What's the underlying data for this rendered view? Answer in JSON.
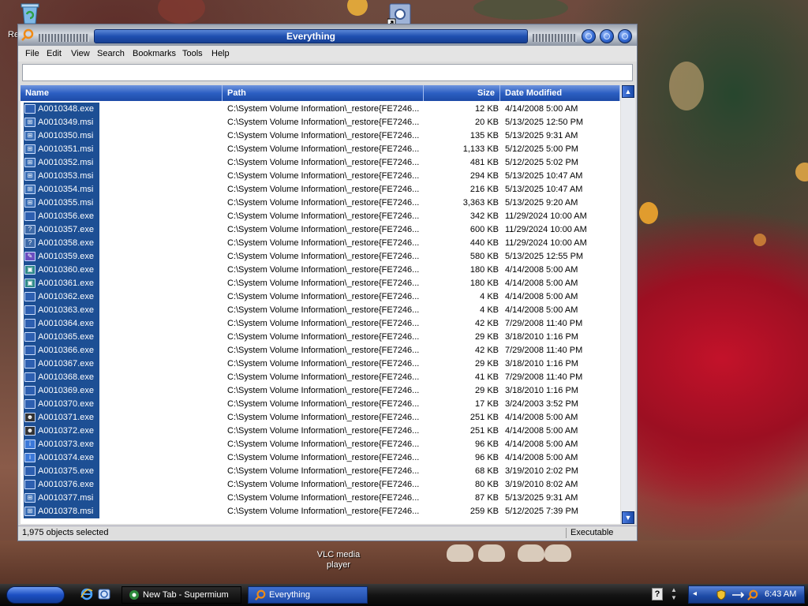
{
  "desktop": {
    "icons": [
      {
        "name": "recycle-bin-icon",
        "label": "Re"
      },
      {
        "name": "shortcut-icon",
        "label": ""
      },
      {
        "name": "vlc-media-player-icon",
        "label": "VLC media player"
      }
    ]
  },
  "window": {
    "title": "Everything",
    "menu": [
      "File",
      "Edit",
      "View",
      "Search",
      "Bookmarks",
      "Tools",
      "Help"
    ],
    "search_value": "",
    "columns": {
      "name": "Name",
      "path": "Path",
      "size": "Size",
      "date": "Date Modified"
    },
    "rows": [
      {
        "name": "A0010348.exe",
        "icon": "exe",
        "path": "C:\\System Volume Information\\_restore{FE7246...",
        "size": "12 KB",
        "date": "4/14/2008 5:00 AM"
      },
      {
        "name": "A0010349.msi",
        "icon": "msi",
        "path": "C:\\System Volume Information\\_restore{FE7246...",
        "size": "20 KB",
        "date": "5/13/2025 12:50 PM"
      },
      {
        "name": "A0010350.msi",
        "icon": "msi",
        "path": "C:\\System Volume Information\\_restore{FE7246...",
        "size": "135 KB",
        "date": "5/13/2025 9:31 AM"
      },
      {
        "name": "A0010351.msi",
        "icon": "msi",
        "path": "C:\\System Volume Information\\_restore{FE7246...",
        "size": "1,133 KB",
        "date": "5/12/2025 5:00 PM"
      },
      {
        "name": "A0010352.msi",
        "icon": "msi",
        "path": "C:\\System Volume Information\\_restore{FE7246...",
        "size": "481 KB",
        "date": "5/12/2025 5:02 PM"
      },
      {
        "name": "A0010353.msi",
        "icon": "msi",
        "path": "C:\\System Volume Information\\_restore{FE7246...",
        "size": "294 KB",
        "date": "5/13/2025 10:47 AM"
      },
      {
        "name": "A0010354.msi",
        "icon": "msi",
        "path": "C:\\System Volume Information\\_restore{FE7246...",
        "size": "216 KB",
        "date": "5/13/2025 10:47 AM"
      },
      {
        "name": "A0010355.msi",
        "icon": "msi",
        "path": "C:\\System Volume Information\\_restore{FE7246...",
        "size": "3,363 KB",
        "date": "5/13/2025 9:20 AM"
      },
      {
        "name": "A0010356.exe",
        "icon": "exe",
        "path": "C:\\System Volume Information\\_restore{FE7246...",
        "size": "342 KB",
        "date": "11/29/2024 10:00 AM"
      },
      {
        "name": "A0010357.exe",
        "icon": "help",
        "path": "C:\\System Volume Information\\_restore{FE7246...",
        "size": "600 KB",
        "date": "11/29/2024 10:00 AM"
      },
      {
        "name": "A0010358.exe",
        "icon": "help",
        "path": "C:\\System Volume Information\\_restore{FE7246...",
        "size": "440 KB",
        "date": "11/29/2024 10:00 AM"
      },
      {
        "name": "A0010359.exe",
        "icon": "pen",
        "path": "C:\\System Volume Information\\_restore{FE7246...",
        "size": "580 KB",
        "date": "5/13/2025 12:55 PM"
      },
      {
        "name": "A0010360.exe",
        "icon": "monitor",
        "path": "C:\\System Volume Information\\_restore{FE7246...",
        "size": "180 KB",
        "date": "4/14/2008 5:00 AM"
      },
      {
        "name": "A0010361.exe",
        "icon": "monitor",
        "path": "C:\\System Volume Information\\_restore{FE7246...",
        "size": "180 KB",
        "date": "4/14/2008 5:00 AM"
      },
      {
        "name": "A0010362.exe",
        "icon": "exe",
        "path": "C:\\System Volume Information\\_restore{FE7246...",
        "size": "4 KB",
        "date": "4/14/2008 5:00 AM"
      },
      {
        "name": "A0010363.exe",
        "icon": "exe",
        "path": "C:\\System Volume Information\\_restore{FE7246...",
        "size": "4 KB",
        "date": "4/14/2008 5:00 AM"
      },
      {
        "name": "A0010364.exe",
        "icon": "exe",
        "path": "C:\\System Volume Information\\_restore{FE7246...",
        "size": "42 KB",
        "date": "7/29/2008 11:40 PM"
      },
      {
        "name": "A0010365.exe",
        "icon": "exe",
        "path": "C:\\System Volume Information\\_restore{FE7246...",
        "size": "29 KB",
        "date": "3/18/2010 1:16 PM"
      },
      {
        "name": "A0010366.exe",
        "icon": "exe",
        "path": "C:\\System Volume Information\\_restore{FE7246...",
        "size": "42 KB",
        "date": "7/29/2008 11:40 PM"
      },
      {
        "name": "A0010367.exe",
        "icon": "exe",
        "path": "C:\\System Volume Information\\_restore{FE7246...",
        "size": "29 KB",
        "date": "3/18/2010 1:16 PM"
      },
      {
        "name": "A0010368.exe",
        "icon": "exe",
        "path": "C:\\System Volume Information\\_restore{FE7246...",
        "size": "41 KB",
        "date": "7/29/2008 11:40 PM"
      },
      {
        "name": "A0010369.exe",
        "icon": "exe",
        "path": "C:\\System Volume Information\\_restore{FE7246...",
        "size": "29 KB",
        "date": "3/18/2010 1:16 PM"
      },
      {
        "name": "A0010370.exe",
        "icon": "exe",
        "path": "C:\\System Volume Information\\_restore{FE7246...",
        "size": "17 KB",
        "date": "3/24/2003 3:52 PM"
      },
      {
        "name": "A0010371.exe",
        "icon": "spy",
        "path": "C:\\System Volume Information\\_restore{FE7246...",
        "size": "251 KB",
        "date": "4/14/2008 5:00 AM"
      },
      {
        "name": "A0010372.exe",
        "icon": "spy",
        "path": "C:\\System Volume Information\\_restore{FE7246...",
        "size": "251 KB",
        "date": "4/14/2008 5:00 AM"
      },
      {
        "name": "A0010373.exe",
        "icon": "info",
        "path": "C:\\System Volume Information\\_restore{FE7246...",
        "size": "96 KB",
        "date": "4/14/2008 5:00 AM"
      },
      {
        "name": "A0010374.exe",
        "icon": "info",
        "path": "C:\\System Volume Information\\_restore{FE7246...",
        "size": "96 KB",
        "date": "4/14/2008 5:00 AM"
      },
      {
        "name": "A0010375.exe",
        "icon": "exe",
        "path": "C:\\System Volume Information\\_restore{FE7246...",
        "size": "68 KB",
        "date": "3/19/2010 2:02 PM"
      },
      {
        "name": "A0010376.exe",
        "icon": "exe",
        "path": "C:\\System Volume Information\\_restore{FE7246...",
        "size": "80 KB",
        "date": "3/19/2010 8:02 AM"
      },
      {
        "name": "A0010377.msi",
        "icon": "msi",
        "path": "C:\\System Volume Information\\_restore{FE7246...",
        "size": "87 KB",
        "date": "5/13/2025 9:31 AM"
      },
      {
        "name": "A0010378.msi",
        "icon": "msi",
        "path": "C:\\System Volume Information\\_restore{FE7246...",
        "size": "259 KB",
        "date": "5/12/2025 7:39 PM"
      }
    ],
    "status": {
      "left": "1,975 objects selected",
      "right": "Executable"
    }
  },
  "taskbar": {
    "tasks": [
      {
        "label": "New Tab - Supermium",
        "icon": "supermium-icon"
      },
      {
        "label": "Everything",
        "icon": "everything-icon"
      }
    ],
    "clock": "6:43 AM"
  },
  "colors": {
    "selection": "#1d4f94",
    "header": "#2c5fc2",
    "title": "#1f4fb0"
  }
}
